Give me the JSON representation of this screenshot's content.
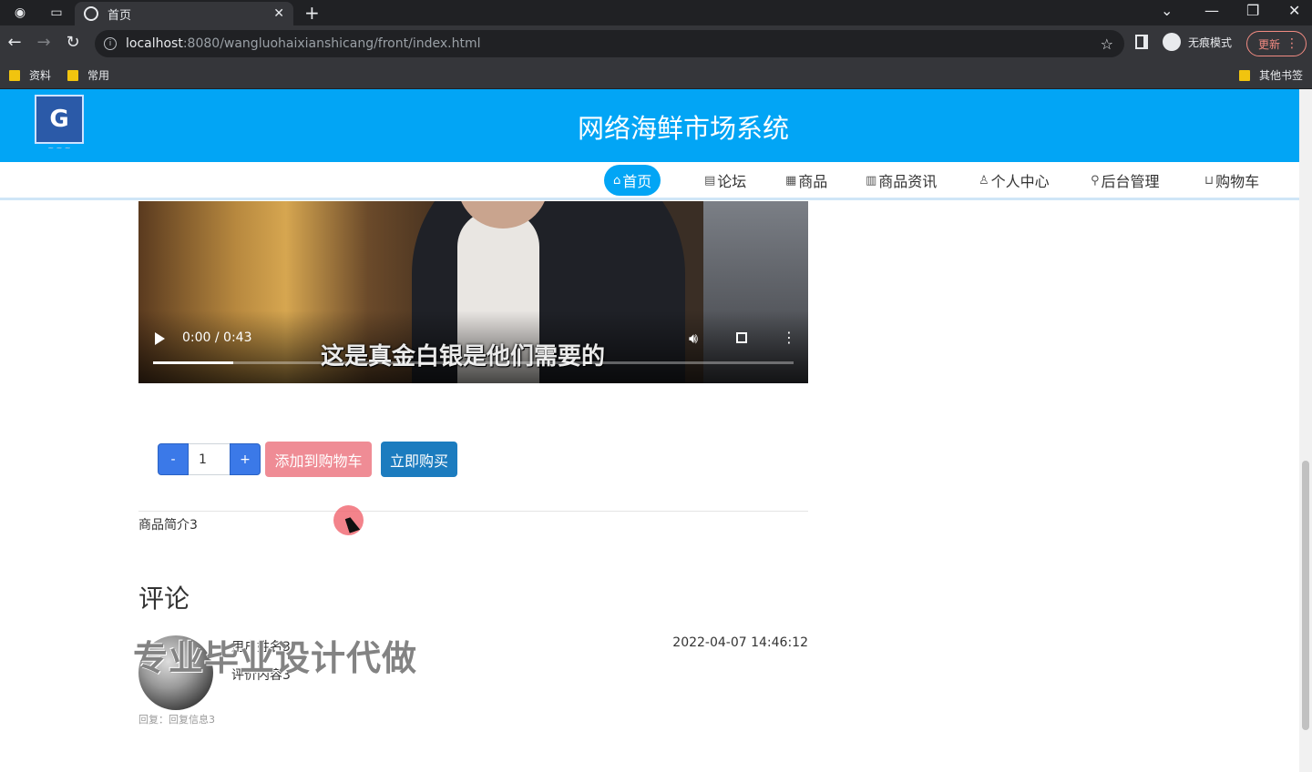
{
  "browser": {
    "tab_title": "首页",
    "url_host": "localhost",
    "url_path": ":8080/wangluohaixianshicang/front/index.html",
    "incognito_label": "无痕模式",
    "update_label": "更新",
    "bookmarks": [
      "资料",
      "常用"
    ],
    "other_bookmarks": "其他书签"
  },
  "site": {
    "title": "网络海鲜市场系统",
    "nav": [
      {
        "label": "首页",
        "icon": "home-icon"
      },
      {
        "label": "论坛",
        "icon": "forum-icon"
      },
      {
        "label": "商品",
        "icon": "gift-icon"
      },
      {
        "label": "商品资讯",
        "icon": "news-icon"
      },
      {
        "label": "个人中心",
        "icon": "user-icon"
      },
      {
        "label": "后台管理",
        "icon": "link-icon"
      },
      {
        "label": "购物车",
        "icon": "cart-icon"
      }
    ]
  },
  "video": {
    "time": "0:00 / 0:43",
    "caption": "这是真金白银是他们需要的",
    "progress": 0.125
  },
  "purchase": {
    "minus": "-",
    "plus": "+",
    "quantity": "1",
    "add_to_cart": "添加到购物车",
    "buy_now": "立即购买"
  },
  "product": {
    "intro": "商品简介3"
  },
  "comments": {
    "title": "评论",
    "items": [
      {
        "name": "用户姓名3",
        "content": "评价内容3",
        "time": "2022-04-07 14:46:12",
        "reply": "回复：回复信息3"
      }
    ]
  },
  "watermark": "专业毕业设计代做",
  "colors": {
    "brand": "#02a5f5",
    "cart_button": "#ef8c95",
    "buy_button": "#1c7cbf",
    "qty_button": "#3b79e8"
  }
}
